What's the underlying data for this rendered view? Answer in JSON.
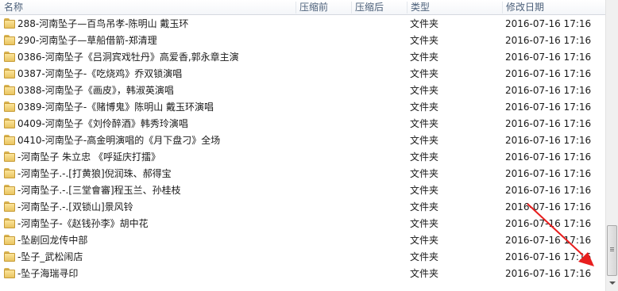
{
  "columns": {
    "name": "名称",
    "compressed_before": "压缩前",
    "compressed_after": "压缩后",
    "type": "类型",
    "modified": "修改日期"
  },
  "files": [
    {
      "name": "288-河南坠子—百鸟吊孝-陈明山 戴玉环",
      "type": "文件夹",
      "date": "2016-07-16 17:16"
    },
    {
      "name": "290-河南坠子—草船借箭-郑清理",
      "type": "文件夹",
      "date": "2016-07-16 17:16"
    },
    {
      "name": "0386-河南坠子《吕洞宾戏牡丹》高爱香,郭永章主演",
      "type": "文件夹",
      "date": "2016-07-16 17:16"
    },
    {
      "name": "0387-河南坠子-《吃烧鸡》乔双锁演唱",
      "type": "文件夹",
      "date": "2016-07-16 17:16"
    },
    {
      "name": "0388-河南坠子《画皮》，韩淑英演唱",
      "type": "文件夹",
      "date": "2016-07-16 17:16"
    },
    {
      "name": "0389-河南坠子-《赌博鬼》陈明山 戴玉环演唱",
      "type": "文件夹",
      "date": "2016-07-16 17:16"
    },
    {
      "name": "0409-河南坠子《刘伶醉酒》韩秀玲演唱",
      "type": "文件夹",
      "date": "2016-07-16 17:16"
    },
    {
      "name": "0410-河南坠子-高金明演唱的《月下盘刁》全场",
      "type": "文件夹",
      "date": "2016-07-16 17:16"
    },
    {
      "name": "-河南坠子 朱立忠 《呼延庆打擂》",
      "type": "文件夹",
      "date": "2016-07-16 17:16"
    },
    {
      "name": "-河南坠子.-.[打黄狼]倪润珠、郝得宝",
      "type": "文件夹",
      "date": "2016-07-16 17:16"
    },
    {
      "name": "-河南坠子.-.[三堂會審]程玉兰、孙桂枝",
      "type": "文件夹",
      "date": "2016-07-16 17:16"
    },
    {
      "name": "-河南坠子.-.[双锁山]景风铃",
      "type": "文件夹",
      "date": "2016-07-16 17:16"
    },
    {
      "name": "-河南坠子-《赵钱孙李》胡中花",
      "type": "文件夹",
      "date": "2016-07-16 17:16"
    },
    {
      "name": "-坠剧回龙传中部",
      "type": "文件夹",
      "date": "2016-07-16 17:16"
    },
    {
      "name": "-坠子_武松闹店",
      "type": "文件夹",
      "date": "2016-07-16 17:16"
    },
    {
      "name": "-坠子海瑞寻印",
      "type": "文件夹",
      "date": "2016-07-16 17:16"
    }
  ],
  "icons": {
    "folder": "folder-icon",
    "annotation": "red-arrow-annotation"
  },
  "colors": {
    "annotation": "#e81e1e",
    "header_text": "#4c607a"
  }
}
